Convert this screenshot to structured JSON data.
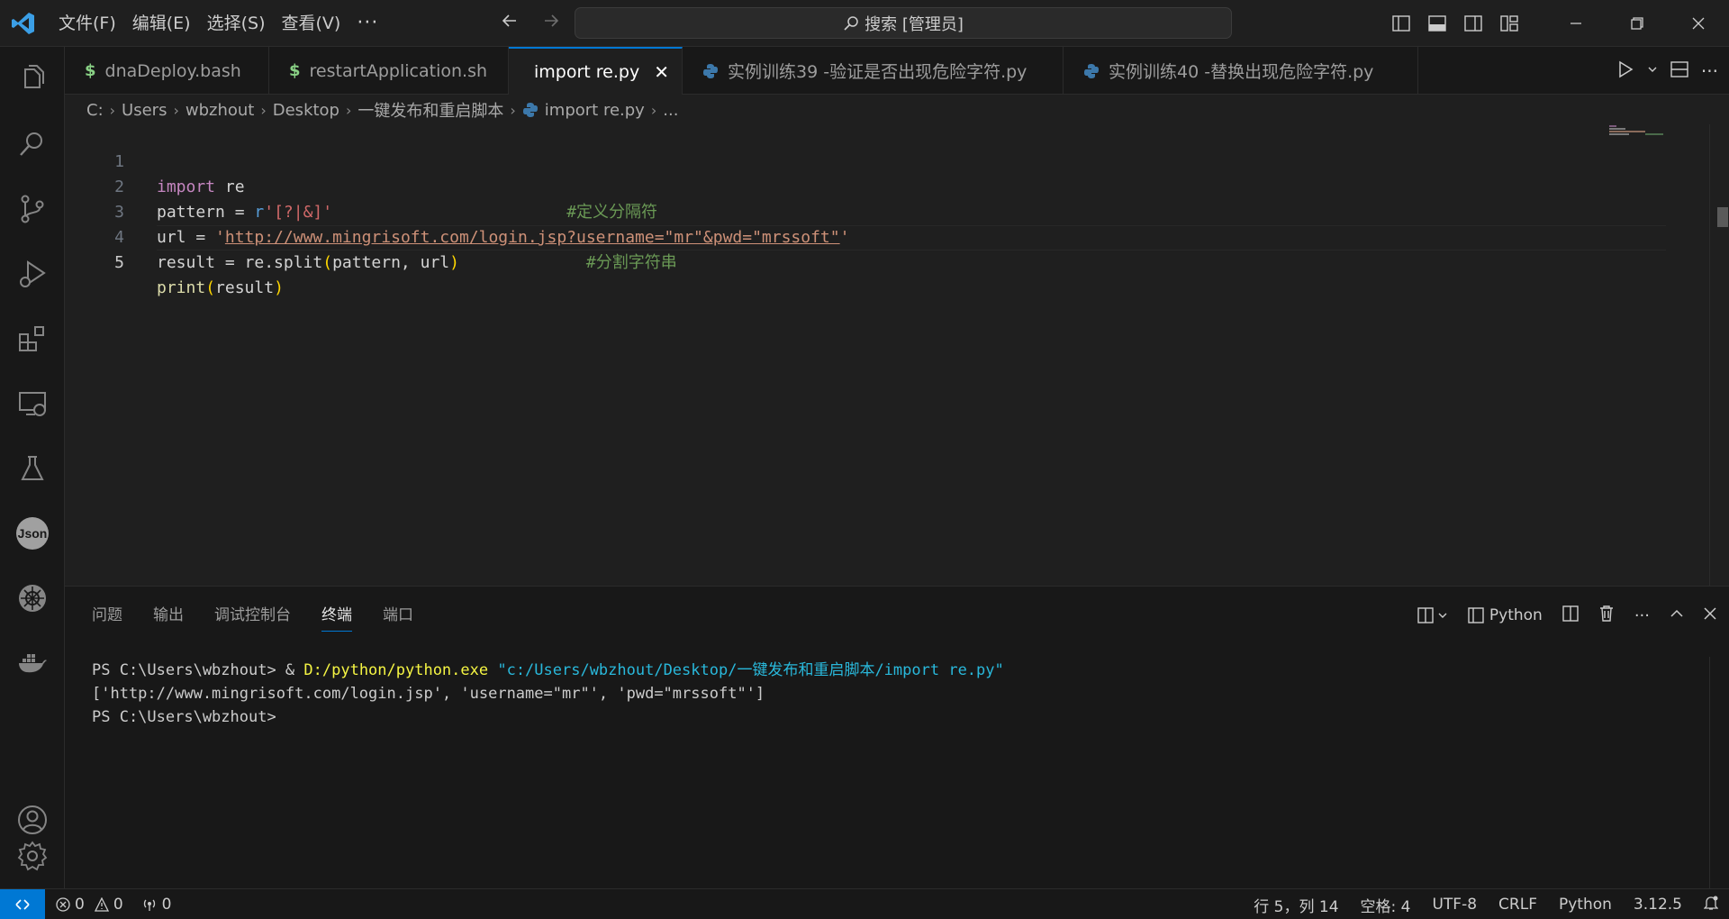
{
  "menu": {
    "items": [
      "文件(F)",
      "编辑(E)",
      "选择(S)",
      "查看(V)"
    ],
    "more": "···"
  },
  "search": {
    "label": "搜索 [管理员]"
  },
  "tabs": [
    {
      "icon": "$",
      "label": "dnaDeploy.bash"
    },
    {
      "icon": "$",
      "label": "restartApplication.sh"
    },
    {
      "icon": "python-icon",
      "label": "import re.py",
      "active": true
    },
    {
      "icon": "python-icon",
      "label": "实例训练39 -验证是否出现危险字符.py"
    },
    {
      "icon": "python-icon",
      "label": "实例训练40 -替换出现危险字符.py"
    }
  ],
  "breadcrumb": {
    "items": [
      "C:",
      "Users",
      "wbzhout",
      "Desktop",
      "一键发布和重启脚本",
      "import re.py",
      "..."
    ]
  },
  "editor": {
    "line_numbers": [
      "1",
      "2",
      "3",
      "4",
      "5"
    ],
    "line1": {
      "kw": "import",
      "rest": " re"
    },
    "line2": {
      "a": "pattern = ",
      "b": "r",
      "c": "'",
      "d": "[?|&]",
      "e": "'",
      "pad": "                        ",
      "comment": "#定义分隔符"
    },
    "line3": {
      "a": "url = ",
      "q1": "'",
      "url": "http://www.mingrisoft.com/login.jsp",
      "rest": "?username=\"mr\"&pwd=\"mrssoft\"",
      "q2": "'"
    },
    "line4": {
      "a": "result = re.split",
      "p1": "(",
      "b": "pattern, url",
      "p2": ")",
      "pad": "             ",
      "comment": "#分割字符串"
    },
    "line5": {
      "fn": "print",
      "p1": "(",
      "b": "result",
      "p2": ")"
    }
  },
  "panel": {
    "tabs": [
      "问题",
      "输出",
      "调试控制台",
      "终端",
      "端口"
    ],
    "active_tab": "终端",
    "terminal_profile": "Python",
    "terminal": {
      "line1_prompt": "PS C:\\Users\\wbzhout> & ",
      "line1_exe": "D:/python/python.exe",
      "line1_arg": " \"c:/Users/wbzhout/Desktop/一键发布和重启脚本/import re.py\"",
      "line2": "['http://www.mingrisoft.com/login.jsp', 'username=\"mr\"', 'pwd=\"mrssoft\"']",
      "line3": "PS C:\\Users\\wbzhout> "
    }
  },
  "statusbar": {
    "errors": "0",
    "warnings": "0",
    "ports": "0",
    "position": "行 5，列 14",
    "spaces": "空格: 4",
    "encoding": "UTF-8",
    "eol": "CRLF",
    "language": "Python",
    "version": "3.12.5"
  },
  "colors": {
    "accent": "#0078d4",
    "background": "#1f1f1f",
    "sidebar": "#181818"
  }
}
